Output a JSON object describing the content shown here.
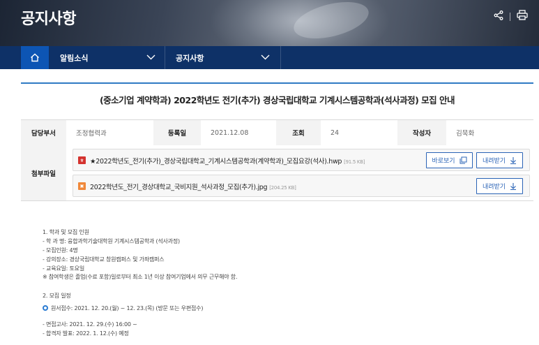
{
  "banner": {
    "title": "공지사항",
    "share_icon": "share-icon",
    "print_icon": "print-icon"
  },
  "nav": {
    "home_icon": "home-icon",
    "menu1": "알림소식",
    "menu2": "공지사항"
  },
  "post": {
    "title": "(중소기업 계약학과) 2022학년도 전기(추가) 경상국립대학교 기계시스템공학과(석사과정) 모집 안내",
    "dept_label": "담당부서",
    "dept_value": "조정협력과",
    "date_label": "등록일",
    "date_value": "2021.12.08",
    "views_label": "조회",
    "views_value": "24",
    "author_label": "작성자",
    "author_value": "김묵화",
    "attach_label": "첨부파일"
  },
  "attachments": [
    {
      "icon": "hwp-file-icon",
      "name": "★2022학년도_전기(추가)_경상국립대학교_기계시스템공학과(계약학과)_모집요강(석사).hwp",
      "size": "[91.5 KB]",
      "view_label": "바로보기",
      "download_label": "내려받기",
      "color": "#d4332f"
    },
    {
      "icon": "jpg-file-icon",
      "name": "2022학년도_전기_경상대학교_국비지원_석사과정_모집(추가).jpg",
      "size": "[204.25 KB]",
      "download_label": "내려받기",
      "color": "#f0883a"
    }
  ],
  "body": {
    "s1_heading": "1. 학과 및 모집 인원",
    "s1_line1": "- 학 과 명: 융합과학기술대학원 기계시스템공학과 (석사과정)",
    "s1_line2": "- 모집인원: 4명",
    "s1_line3": "- 강의장소: 경상국립대학교 창원캠퍼스 및 가좌캠퍼스",
    "s1_line4": "- 교육요일: 토요일",
    "s1_note": "※ 참여학생은 졸업(수료 포함)일로부터 최소 1년 이상 참여기업에서 의무 근무해야 함.",
    "s2_heading": "2. 모집 일정",
    "s2_highlight": "원서접수: 2021. 12. 20.(월) ~ 12. 23.(목) (방문 또는 우편접수)",
    "s2_line1": "- 면접고사: 2021. 12. 29.(수) 16:00 ~",
    "s2_line2": "- 합격자 발표: 2022. 1. 12.(수) 예정"
  }
}
